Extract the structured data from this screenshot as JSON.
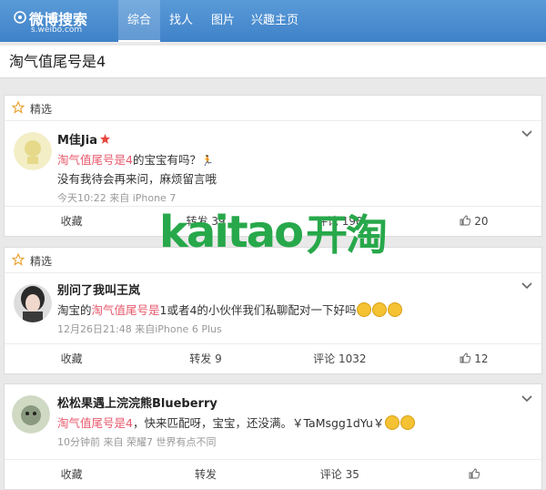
{
  "header": {
    "logo_text": "微博搜索",
    "logo_sub": "s.weibo.com",
    "tabs": [
      {
        "label": "综合",
        "active": true
      },
      {
        "label": "找人",
        "active": false
      },
      {
        "label": "图片",
        "active": false
      },
      {
        "label": "兴趣主页",
        "active": false
      }
    ],
    "accent": "#4a8ed2"
  },
  "search": {
    "query": "淘气值尾号是4"
  },
  "cards": [
    {
      "section": "精选",
      "user": "M佳Jia",
      "lines": [
        {
          "pre": "",
          "hl": "淘气值尾号是4",
          "post": "的宝宝有吗？"
        },
        {
          "pre": "没有我待会再来问，麻烦留言哦",
          "hl": "",
          "post": ""
        }
      ],
      "meta": "今天10:22 来自 iPhone 7",
      "actions": {
        "fav": "收藏",
        "repost": "转发 39",
        "comment": "评论 198",
        "like": "20"
      }
    },
    {
      "section": "精选",
      "user": "别问了我叫王岚",
      "lines": [
        {
          "pre": "淘宝的",
          "hl": "淘气值尾号是",
          "post": "1或者4的小伙伴我们私聊配对一下好吗"
        }
      ],
      "meta": "12月26日21:48 来自iPhone 6 Plus",
      "actions": {
        "fav": "收藏",
        "repost": "转发 9",
        "comment": "评论 1032",
        "like": "12"
      }
    },
    {
      "section": "",
      "user": "松松果遇上浣浣熊Blueberry",
      "lines": [
        {
          "pre": "",
          "hl": "淘气值尾号是4",
          "post": "，快来匹配呀，宝宝，还没满。￥TaMsgg1dYu￥"
        }
      ],
      "meta": "10分钟前 来自 荣耀7 世界有点不同",
      "actions": {
        "fav": "收藏",
        "repost": "转发",
        "comment": "评论 35",
        "like": ""
      }
    }
  ],
  "watermark": {
    "latin": "kaitao",
    "cn": "开淘"
  }
}
